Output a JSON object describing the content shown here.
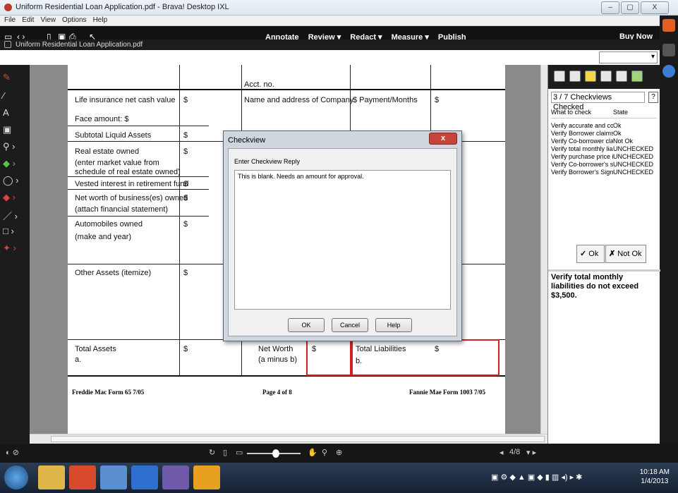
{
  "window": {
    "title": "Uniform Residential Loan Application.pdf - Brava! Desktop IXL",
    "minimize": "–",
    "maximize": "▢",
    "close": "X"
  },
  "menu": [
    "File",
    "Edit",
    "View",
    "Options",
    "Help"
  ],
  "toolbar": {
    "menus": [
      "Annotate",
      "Review ▾",
      "Redact ▾",
      "Measure ▾",
      "Publish"
    ],
    "buy_now": "Buy Now",
    "file_tab": "Uniform Residential Loan Application.pdf"
  },
  "document": {
    "rows": {
      "acct_no": "Acct. no.",
      "life_insurance": "Life insurance net cash value",
      "life_dollar": "$",
      "company": "Name and address of Company",
      "payment_months": "$ Payment/Months",
      "payment_dollar": "$",
      "face_amount": "Face amount: $",
      "subtotal": "Subtotal Liquid Assets",
      "subtotal_dollar": "$",
      "real_estate": "Real estate owned",
      "real_estate_note1": "(enter market value from",
      "real_estate_note2": "schedule of real estate owned)",
      "real_estate_dollar": "$",
      "vested": "Vested interest in retirement fund",
      "vested_dollar": "$",
      "net_worth_biz": "Net worth of business(es) owned",
      "net_worth_biz_note": "(attach financial statement)",
      "net_worth_biz_dollar": "$",
      "automobiles": "Automobiles owned",
      "automobiles_note": "(make and year)",
      "automobiles_dollar": "$",
      "other_assets": "Other Assets (itemize)",
      "other_assets_dollar": "$",
      "total_assets": "Total Assets",
      "total_assets_a": "a.",
      "total_assets_dollar": "$",
      "net_worth": "Net Worth",
      "net_worth_note": "(a minus b)",
      "net_worth_dollar": "$",
      "total_liabilities": "Total Liabilities",
      "total_liabilities_b": "b.",
      "total_liabilities_dollar": "$"
    },
    "footer_left": "Freddie Mac Form 65   7/05",
    "footer_center": "Page 4 of 8",
    "footer_right": "Fannie Mae Form 1003   7/05"
  },
  "checkview_panel": {
    "status": "3 / 7 Checkviews Checked",
    "help": "?",
    "col_what": "What to check",
    "col_state": "State",
    "items": [
      {
        "what": "Verify accurate and co...",
        "state": "Ok"
      },
      {
        "what": "Verify Borrower claims ...",
        "state": "Ok"
      },
      {
        "what": "Verify Co-borrower clai...",
        "state": "Not Ok"
      },
      {
        "what": "Verify total monthly liab...",
        "state": "UNCHECKED"
      },
      {
        "what": "Verify purchase price i...",
        "state": "UNCHECKED"
      },
      {
        "what": "Verify Co-borrower's si...",
        "state": "UNCHECKED"
      },
      {
        "what": "Verify Borrower's Signa...",
        "state": "UNCHECKED"
      }
    ],
    "ok_label": "Ok",
    "not_ok_label": "Not Ok",
    "description": "Verify total monthly liabilities do not exceed $3,500."
  },
  "dialog": {
    "title": "Checkview",
    "close": "x",
    "label": "Enter Checkview Reply",
    "reply": "This is blank. Needs an amount for approval.",
    "ok": "OK",
    "cancel": "Cancel",
    "help": "Help"
  },
  "statusbar": {
    "page": "4/8"
  },
  "clock": {
    "time": "10:18 AM",
    "date": "1/4/2013"
  },
  "colors": {
    "dark": "#121212",
    "highlight_red": "#d42020",
    "dialog_close": "#c6443a"
  }
}
